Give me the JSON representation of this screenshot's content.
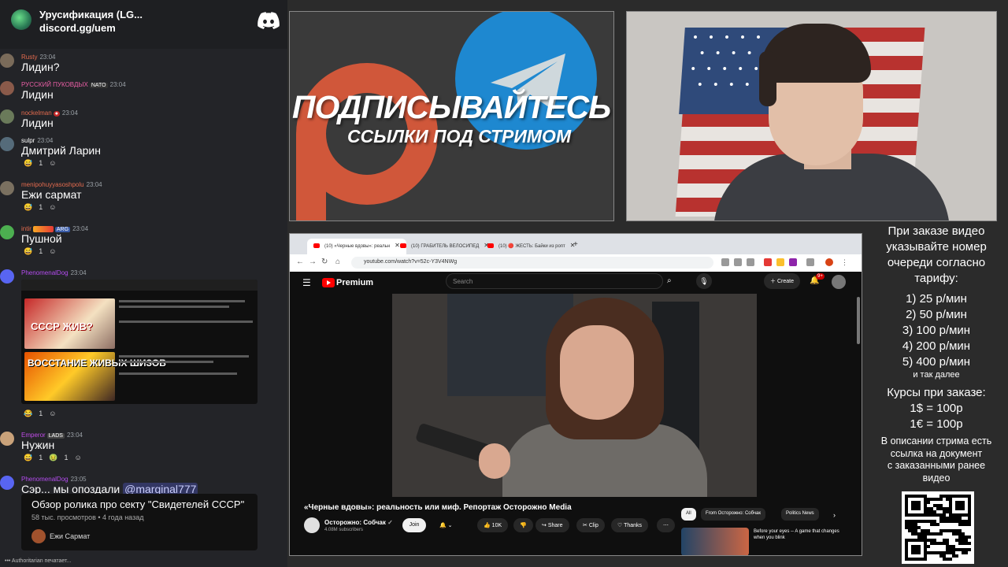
{
  "chat": {
    "server_name": "Урусификация (LG...",
    "server_link": "discord.gg/uem",
    "messages": [
      {
        "user": "Rusty",
        "user_color": "#e36b4e",
        "time": "23:04",
        "text": "Лидин?",
        "badges": []
      },
      {
        "user": "РУССКИЙ ПУКОВДЫХ",
        "user_color": "#ea5fa6",
        "time": "23:04",
        "text": "Лидин",
        "badges": [
          "NATO"
        ]
      },
      {
        "user": "nockelman",
        "user_color": "#e36b4e",
        "time": "23:04",
        "text": "Лидин",
        "badges": []
      },
      {
        "user": "sulpr",
        "user_color": "#ffffff",
        "time": "23:04",
        "text": "Дмитрий Ларин",
        "badges": [],
        "reaction_count": "1"
      },
      {
        "user": "menipohuyyasoshpolu",
        "user_color": "#e36b4e",
        "time": "23:04",
        "text": "Ежи сармат",
        "badges": [],
        "reaction_count": "1"
      },
      {
        "user": "intir",
        "user_color": "#e36b4e",
        "time": "23:04",
        "text": "Пушной",
        "badges": [
          "ARG"
        ],
        "reaction_count": "1"
      },
      {
        "user": "PhenomenalDog",
        "user_color": "#b44cf0",
        "time": "23:04",
        "text": "",
        "badges": [],
        "reaction_count": "1"
      },
      {
        "user": "Emperor",
        "user_color": "#c04ce8",
        "time": "23:04",
        "text": "Нужин",
        "badges": [
          "LADS"
        ],
        "reaction_count": "1",
        "reaction_count_2": "1"
      },
      {
        "user": "PhenomenalDog",
        "user_color": "#b44cf0",
        "time": "23:05",
        "text": "Сэр... мы опоздали",
        "mention": "@marginal777",
        "badges": []
      }
    ],
    "thumb_text_1": "СССР ЖИВ?",
    "thumb_text_2": "ВОССТАНИЕ ЖИВЫХ ШИЗОВ",
    "yt_card": {
      "title": "Обзор ролика про секту \"Свидетелей СССР\"",
      "meta": "58 тыс. просмотров • 4 года назад",
      "author": "Ежи Сармат"
    },
    "typing": "Authoritarian печатает..."
  },
  "banner": {
    "title": "ПОДПИСЫВАЙТЕСЬ",
    "subtitle": "ССЫЛКИ ПОД СТРИМОМ"
  },
  "browser": {
    "tabs": [
      "(10) «Черные вдовы»: реальн",
      "(10) ГРАБИТЕЛЬ ВЕЛОСИПЕД",
      "(10) 🔴 ЖЕСТЬ: Байки из ропт"
    ],
    "url": "youtube.com/watch?v=52c-Y3V4NWg",
    "premium_label": "Premium",
    "search_placeholder": "Search",
    "create_label": "Create",
    "notif_badge": "9+",
    "video_title": "«Черные вдовы»: реальность или миф. Репортаж Осторожно Media",
    "channel_name": "Осторожно: Собчак",
    "channel_subs": "4.08M subscribers",
    "join_label": "Join",
    "likes": "10K",
    "share_label": "Share",
    "clip_label": "Clip",
    "thanks_label": "Thanks",
    "chips": [
      "All",
      "From Осторожно: Собчак",
      "Politics News"
    ],
    "rec_title": "Before your eyes -- A game that changes when you blink"
  },
  "info": {
    "order_lines": [
      "При заказе видео",
      "указывайте номер",
      "очереди согласно",
      "тарифу:"
    ],
    "tariffs": [
      "1) 25 р/мин",
      "2) 50 р/мин",
      "3) 100 р/мин",
      "4) 200 р/мин",
      "5) 400 р/мин"
    ],
    "etc": "и так далее",
    "rates_title": "Курсы при заказе:",
    "rates": [
      "1$ = 100р",
      "1€ = 100р"
    ],
    "desc_lines": [
      "В описании стрима есть",
      "ссылка на документ",
      "с заказанными ранее",
      "видео"
    ]
  }
}
